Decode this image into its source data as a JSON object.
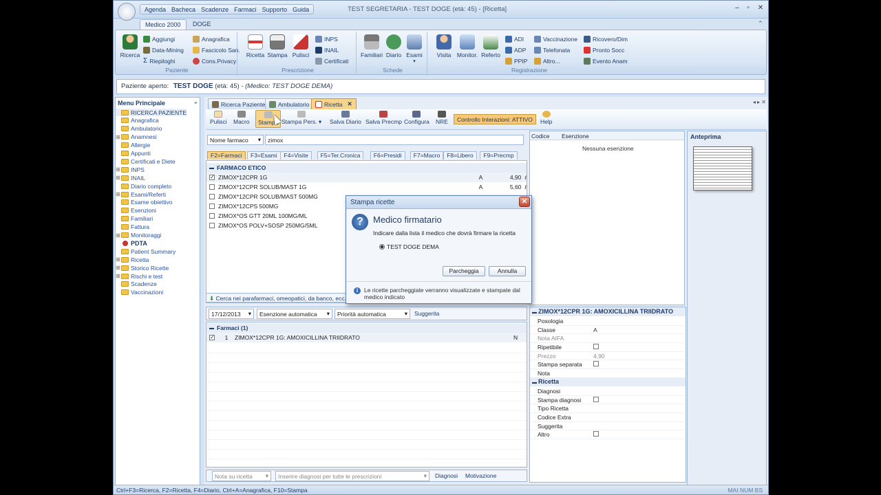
{
  "window": {
    "title": "TEST SEGRETARIA - TEST DOGE (età: 45)   - [Ricetta]"
  },
  "quick_access": [
    "Agenda",
    "Bacheca",
    "Scadenze",
    "Farmaci",
    "Supporto",
    "Guida"
  ],
  "ribbon_tabs": [
    "Medico 2000",
    "DOGE"
  ],
  "ribbon": {
    "paziente": {
      "label": "Paziente",
      "ricerca": "Ricerca",
      "aggiungi": "Aggiungi",
      "datamining": "Data-Mining",
      "riepiloghi": "Riepiloghi",
      "anagrafica": "Anagrafica",
      "fascicolo": "Fascicolo San.",
      "privacy": "Cons.Privacy"
    },
    "prescrizione": {
      "label": "Prescrizione",
      "ricetta": "Ricetta",
      "stampa": "Stampa",
      "pulisci": "Pulisci",
      "inps": "INPS",
      "inail": "INAIL",
      "certificati": "Certificati"
    },
    "schede": {
      "label": "Schede",
      "familiari": "Familiari",
      "diario": "Diario",
      "esami": "Esami"
    },
    "registrazione": {
      "label": "Registrazione",
      "visita": "Visita",
      "monitor": "Monitor.",
      "referto": "Referto",
      "adi": "ADI",
      "adp": "ADP",
      "ppip": "PPIP",
      "vaccinazione": "Vaccinazione",
      "telefonata": "Telefonata",
      "altro": "Altro...",
      "ricovero": "Ricovero/Dim",
      "pronto": "Pronto Socc",
      "evento": "Evento Anam"
    }
  },
  "patient_bar": {
    "label": "Paziente aperto:",
    "name": "TEST DOGE",
    "age": "(età: 45)",
    "medico": "- (Medico: TEST DOGE DEMA)"
  },
  "menu": {
    "title": "Menu Principale",
    "items": [
      "RICERCA PAZIENTE",
      "Anagrafica",
      "Ambulatorio",
      "Anamnesi",
      "Allergie",
      "Appunti",
      "Certificati e Diete",
      "INPS",
      "INAIL",
      "Diario completo",
      "Esami/Referti",
      "Esame obiettivo",
      "Esenzioni",
      "Familiari",
      "Fattura",
      "Monitoraggi",
      "PDTA",
      "Patient Summary",
      "Ricetta",
      "Storico Ricette",
      "Rischi e test",
      "Scadenze",
      "Vaccinazioni"
    ]
  },
  "doc_tabs": [
    "Ricerca Paziente",
    "Ambulatorio",
    "Ricetta"
  ],
  "toolbar": {
    "pulisci": "Pulisci",
    "macro": "Macro",
    "stampa": "Stampa",
    "stampa_pers": "Stampa Pers.",
    "salva_diario": "Salva Diario",
    "salva_precmp": "Salva Precmp",
    "configura": "Configura",
    "nre": "NRE",
    "interazioni": "Controllo Interazioni: ATTIVO",
    "help": "Help"
  },
  "search": {
    "mode": "Nome farmaco",
    "value": "zimox"
  },
  "filter_tabs": [
    "F2=Farmaci",
    "F3=Esami",
    "F4=Visite",
    "F5=Ter.Cronica",
    "F6=Presidi",
    "F7=Macro",
    "F8=Libero",
    "F9=Precmp"
  ],
  "drug_group": "FARMACO ETICO",
  "drugs": [
    {
      "name": "ZIMOX*12CPR 1G",
      "class": "A",
      "price": "4,90",
      "checked": true
    },
    {
      "name": "ZIMOX*12CPR SOLUB/MAST 1G",
      "class": "A",
      "price": "5,60",
      "checked": false
    },
    {
      "name": "ZIMOX*12CPR SOLUB/MAST 500MG",
      "class": "",
      "price": "",
      "checked": false
    },
    {
      "name": "ZIMOX*12CPS 500MG",
      "class": "",
      "price": "",
      "checked": false
    },
    {
      "name": "ZIMOX*OS GTT 20ML 100MG/ML",
      "class": "",
      "price": "",
      "checked": false
    },
    {
      "name": "ZIMOX*OS POLV+SOSP 250MG/5ML",
      "class": "",
      "price": "",
      "checked": false
    }
  ],
  "search_others": "Cerca nei parafarmaci, omeopatici, da banco, ecc.",
  "exemption": {
    "col_code": "Codice",
    "col_desc": "Esenzione",
    "empty": "Nessuna esenzione"
  },
  "preview": {
    "title": "Anteprima"
  },
  "prescription": {
    "date": "17/12/2013",
    "exemption": "Esenzione automatica",
    "priority": "Priorità automatica",
    "suggested": "Suggerita",
    "group": "Farmaci (1)",
    "items": [
      {
        "num": "1",
        "name": "ZIMOX*12CPR 1G: AMOXICILLINA TRIIDRATO",
        "flag": "N"
      }
    ]
  },
  "bottom": {
    "note_placeholder": "Nota su ricetta",
    "diag_placeholder": "Inserire diagnosi per tutte le prescrizioni",
    "diagnosi": "Diagnosi",
    "motivazione": "Motivazione"
  },
  "props": {
    "title": "ZIMOX*12CPR 1G: AMOXICILLINA TRIIDRATO",
    "rows": [
      {
        "k": "Posologia",
        "v": "",
        "t": ""
      },
      {
        "k": "Classe",
        "v": "A",
        "t": ""
      },
      {
        "k": "Nota AIFA",
        "v": "",
        "t": "",
        "s": 1
      },
      {
        "k": "Ripetibile",
        "v": "",
        "t": "cb"
      },
      {
        "k": "Prezzo",
        "v": "4,90",
        "t": "",
        "s": 1
      },
      {
        "k": "Stampa separata",
        "v": "",
        "t": "cb"
      },
      {
        "k": "Nota",
        "v": "",
        "t": ""
      }
    ],
    "section2": "Ricetta",
    "rows2": [
      {
        "k": "Diagnosi",
        "t": ""
      },
      {
        "k": "Stampa diagnosi",
        "t": "cb"
      },
      {
        "k": "Tipo Ricetta",
        "t": ""
      },
      {
        "k": "Codice Extra",
        "t": ""
      },
      {
        "k": "Suggerita",
        "t": ""
      },
      {
        "k": "Altro",
        "t": "cb"
      }
    ]
  },
  "dialog": {
    "title": "Stampa ricette",
    "heading": "Medico firmatario",
    "text": "Indicare dalla lista il medico che dovrà firmare la ricetta",
    "option": "TEST DOGE DEMA",
    "park": "Parcheggia",
    "cancel": "Annulla",
    "info": "Le ricette parcheggiate verranno visualizzate e stampate dal medico indicato"
  },
  "status": {
    "shortcuts": "Ctrl+F3=Ricerca, F2=Ricetta, F4=Diario, Ctrl+A=Anagrafica, F10=Stampa",
    "indicators": "MAI  NUM  BS"
  }
}
